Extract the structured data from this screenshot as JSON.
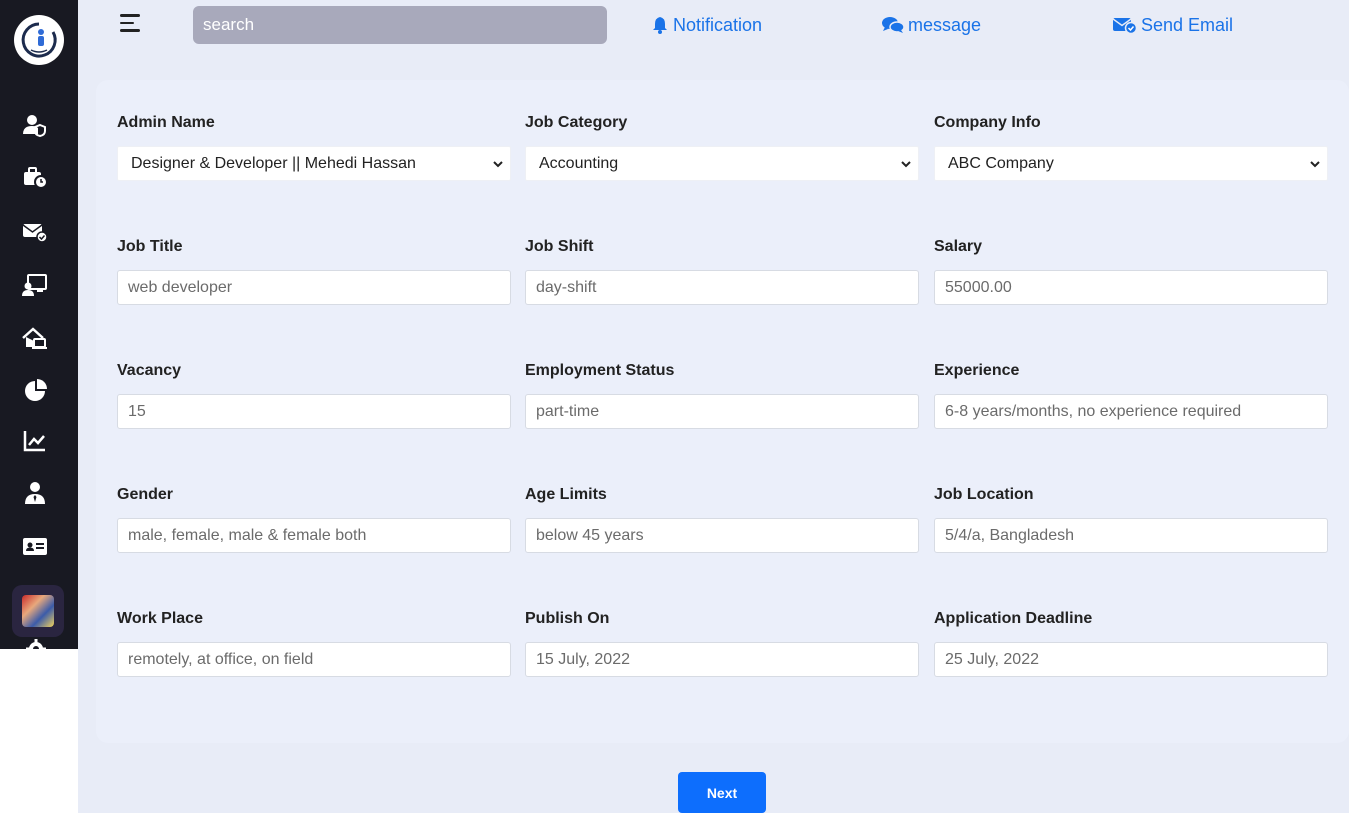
{
  "brand": {
    "logo_name": "logo-icon"
  },
  "sidebar": {
    "items": [
      {
        "icon": "user-shield-icon"
      },
      {
        "icon": "briefcase-clock-icon"
      },
      {
        "icon": "envelope-check-icon"
      },
      {
        "icon": "chalkboard-user-icon"
      },
      {
        "icon": "house-laptop-icon"
      },
      {
        "icon": "pie-chart-icon"
      },
      {
        "icon": "line-chart-icon"
      },
      {
        "icon": "user-tie-icon"
      },
      {
        "icon": "id-card-icon"
      }
    ]
  },
  "topbar": {
    "search_placeholder": "search",
    "notification_label": "Notification",
    "message_label": "message",
    "send_email_label": "Send Email",
    "link_color": "#1a73e8"
  },
  "form": {
    "admin_name": {
      "label": "Admin Name",
      "value": "Designer & Developer || Mehedi Hassan"
    },
    "job_category": {
      "label": "Job Category",
      "value": "Accounting"
    },
    "company_info": {
      "label": "Company Info",
      "value": "ABC Company"
    },
    "job_title": {
      "label": "Job Title",
      "placeholder": "web developer"
    },
    "job_shift": {
      "label": "Job Shift",
      "placeholder": "day-shift"
    },
    "salary": {
      "label": "Salary",
      "placeholder": "55000.00"
    },
    "vacancy": {
      "label": "Vacancy",
      "placeholder": "15"
    },
    "employment_status": {
      "label": "Employment Status",
      "placeholder": "part-time"
    },
    "experience": {
      "label": "Experience",
      "placeholder": "6-8 years/months, no experience required"
    },
    "gender": {
      "label": "Gender",
      "placeholder": "male, female, male & female both"
    },
    "age_limits": {
      "label": "Age Limits",
      "placeholder": "below 45 years"
    },
    "job_location": {
      "label": "Job Location",
      "placeholder": "5/4/a, Bangladesh"
    },
    "work_place": {
      "label": "Work Place",
      "placeholder": "remotely, at office, on field"
    },
    "publish_on": {
      "label": "Publish On",
      "placeholder": "15 July, 2022"
    },
    "application_deadline": {
      "label": "Application Deadline",
      "placeholder": "25 July, 2022"
    }
  },
  "next_button": {
    "label": "Next",
    "color": "#0d6efd"
  }
}
